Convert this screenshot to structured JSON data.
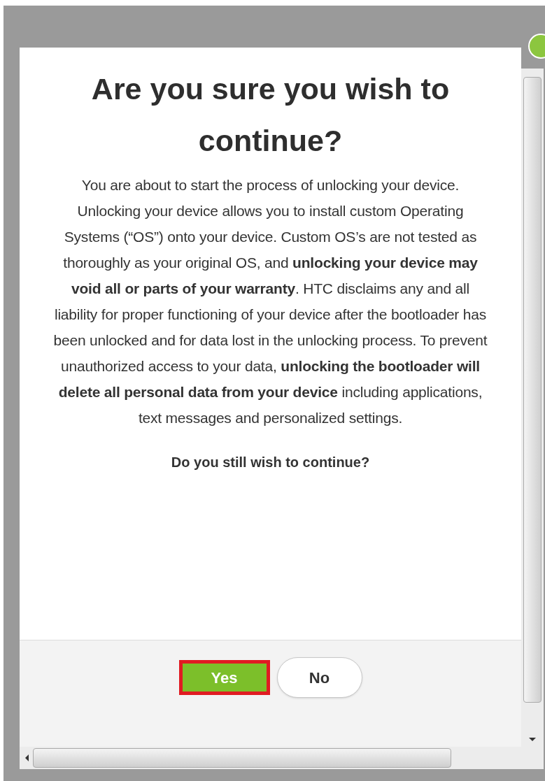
{
  "dialog": {
    "title": "Are you sure you wish to continue?",
    "body": "You are about to start the process of unlocking your device. Unlocking your device allows you to install custom Operating Systems (“OS”) onto your device. Custom OS’s are not tested as thoroughly as your original OS, and **unlocking your device may void all or parts of your warranty**. HTC disclaims any and all liability for proper functioning of your device after the bootloader has been unlocked and for data lost in the unlocking process. To prevent unauthorized access to your data, **unlocking the bootloader will delete all personal data from your device** including applications, text messages and personalized settings.",
    "question": "Do you still wish to continue?",
    "buttons": [
      {
        "label": "Yes",
        "kind": "primary",
        "highlighted": true
      },
      {
        "label": "No",
        "kind": "secondary",
        "highlighted": false
      }
    ]
  }
}
